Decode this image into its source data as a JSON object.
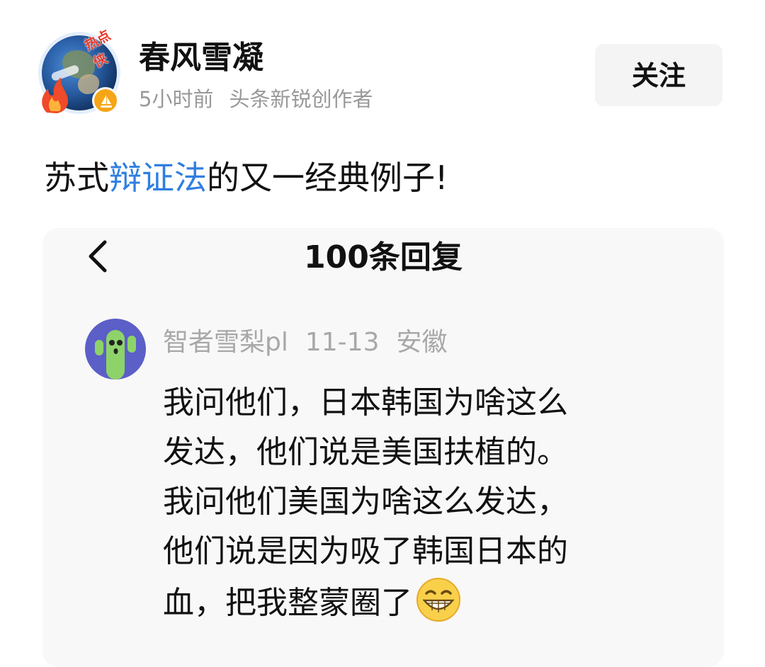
{
  "header": {
    "author_name": "春风雪凝",
    "avatar_badge_text": "热点侠",
    "time_ago": "5小时前",
    "author_tag": "头条新锐创作者",
    "follow_label": "关注"
  },
  "post": {
    "title_prefix": "苏式",
    "title_tag": "辩证法",
    "title_suffix": "的又一经典例子!"
  },
  "embedded": {
    "title": "100条回复",
    "comment": {
      "username": "智者雪梨pl",
      "date": "11-13",
      "location": "安徽",
      "lines": [
        "我问他们，日本韩国为啥这么",
        "发达，他们说是美国扶植的。",
        "我问他们美国为啥这么发达，",
        "他们说是因为吸了韩国日本的",
        "血，把我整蒙圈了"
      ]
    }
  },
  "icons": {
    "back": "chevron-left-icon",
    "emoji": "grinning-face-emoji",
    "badge": "sailboat-icon"
  },
  "colors": {
    "tag_blue": "#2f7fe0",
    "meta_gray": "#999999",
    "badge_orange": "#f5a516"
  }
}
